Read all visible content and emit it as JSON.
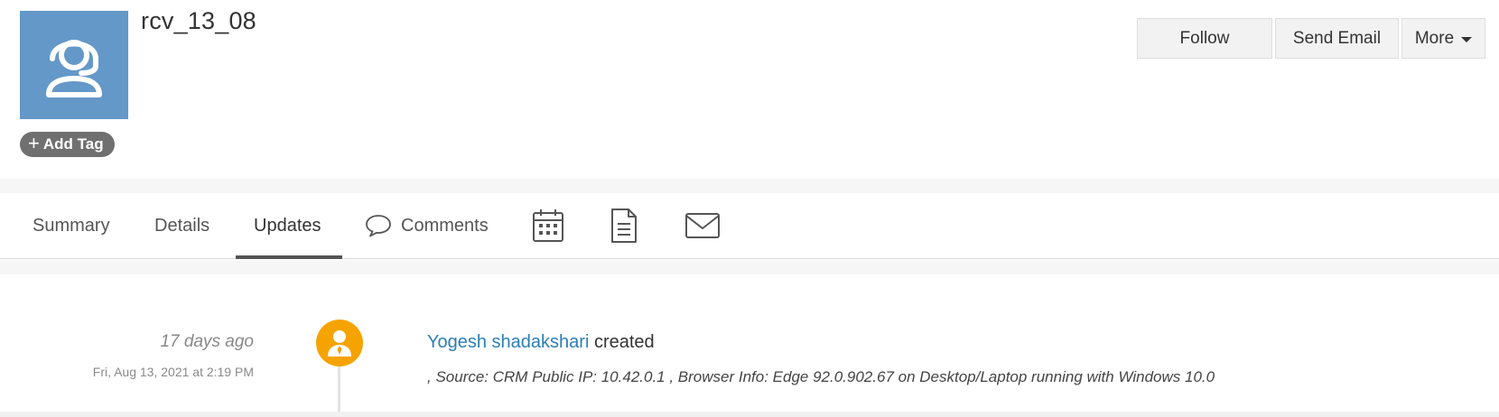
{
  "record": {
    "name": "rcv_13_08",
    "avatar_icon": "headset-user-icon",
    "add_tag_label": "Add Tag"
  },
  "actions": {
    "follow_label": "Follow",
    "send_email_label": "Send Email",
    "more_label": "More"
  },
  "tabs": {
    "summary": "Summary",
    "details": "Details",
    "updates": "Updates",
    "comments": "Comments",
    "active": "Updates",
    "icons": [
      "calendar-icon",
      "document-icon",
      "envelope-icon"
    ]
  },
  "update": {
    "time_ago": "17 days ago",
    "timestamp": "Fri, Aug 13, 2021 at 2:19 PM",
    "user": "Yogesh shadakshari",
    "action": "created",
    "detail": ", Source: CRM Public IP: 10.42.0.1 , Browser Info: Edge 92.0.902.67 on Desktop/Laptop running with Windows 10.0"
  },
  "colors": {
    "avatar_bg": "#6398c8",
    "user_avatar_bg": "#f5a300",
    "link": "#2a7fb5",
    "tag_bg": "#707070"
  }
}
